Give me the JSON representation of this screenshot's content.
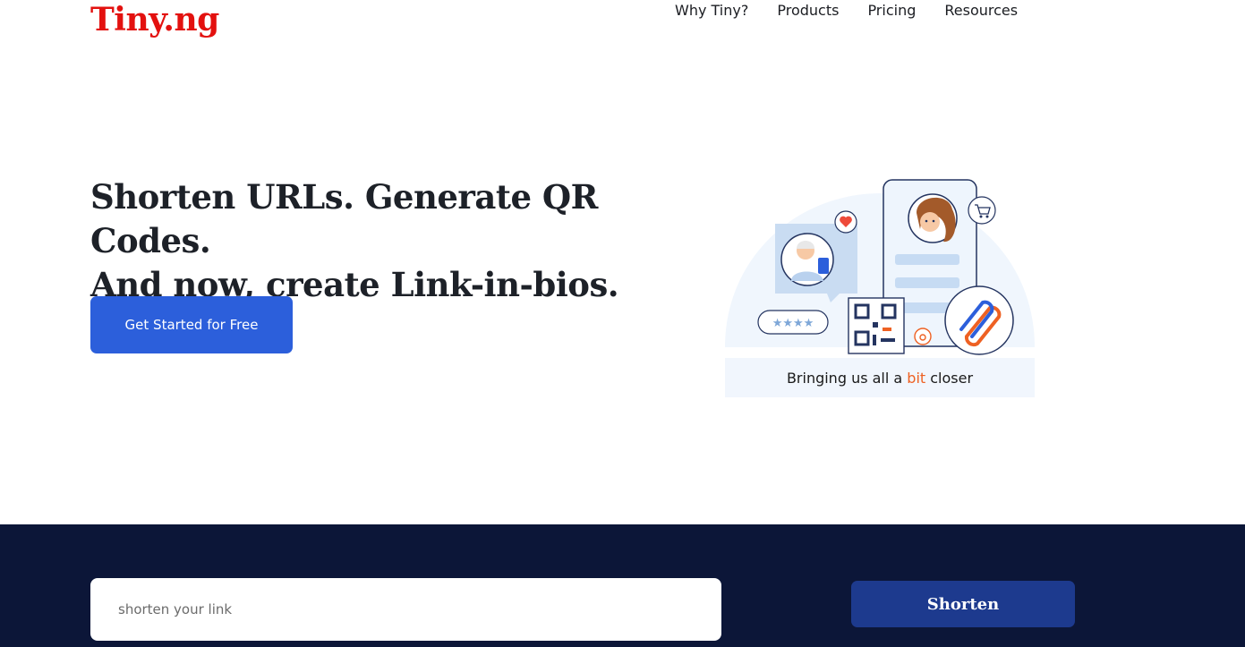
{
  "header": {
    "logo_text": "Tiny.ng",
    "nav": [
      {
        "label": "Why Tiny?"
      },
      {
        "label": "Products"
      },
      {
        "label": "Pricing"
      },
      {
        "label": "Resources"
      }
    ]
  },
  "hero": {
    "title_line1": "Shorten URLs. Generate QR Codes.",
    "title_line2": "And now, create Link-in-bios.",
    "cta_label": "Get Started for Free"
  },
  "illustration": {
    "caption_before": "Bringing us all a ",
    "caption_accent": "bit",
    "caption_after": " closer"
  },
  "shortener": {
    "input_value": "",
    "input_placeholder": "shorten your link",
    "button_label": "Shorten"
  },
  "colors": {
    "logo": "#e3110f",
    "cta": "#2c5fdb",
    "dark_band": "#0c1638",
    "shorten_button": "#1d3a8e",
    "caption_accent": "#ee6123"
  }
}
